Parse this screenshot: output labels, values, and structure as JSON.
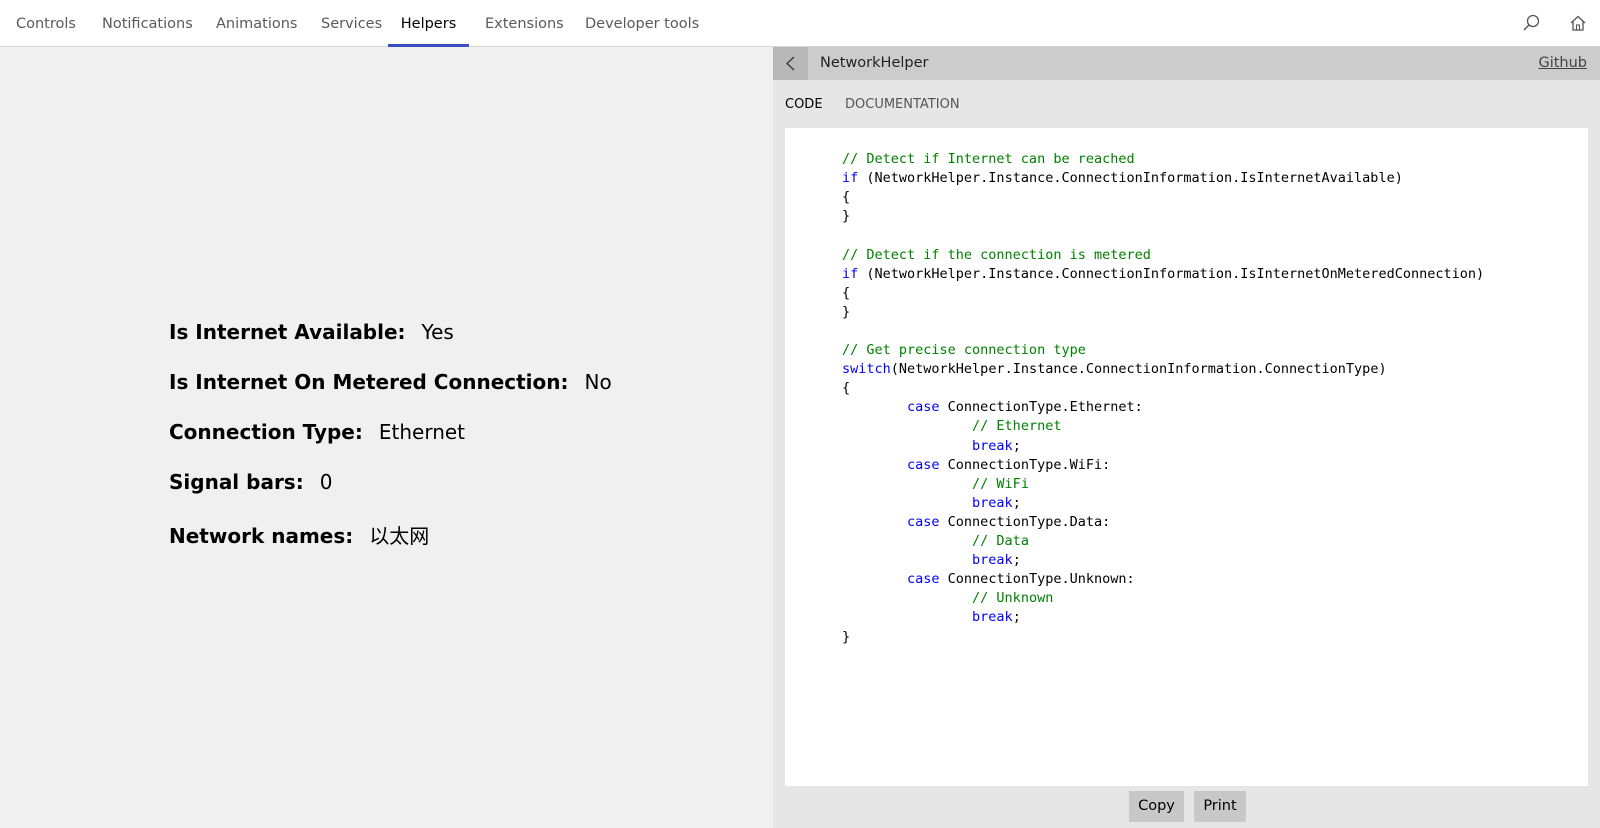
{
  "nav": {
    "items": [
      {
        "label": "Controls",
        "active": false
      },
      {
        "label": "Notifications",
        "active": false
      },
      {
        "label": "Animations",
        "active": false
      },
      {
        "label": "Services",
        "active": false
      },
      {
        "label": "Helpers",
        "active": true
      },
      {
        "label": "Extensions",
        "active": false
      },
      {
        "label": "Developer tools",
        "active": false
      }
    ],
    "icons": {
      "search": "search-icon",
      "home": "home-icon"
    }
  },
  "colors": {
    "accent": "#3a4fc0",
    "nav_background": "#ffffff",
    "content_background": "#f0f0f0",
    "panel_background": "#e6e6e6",
    "panel_header": "#cccccc",
    "code_comment": "#008000",
    "code_keyword": "#0000ff",
    "button_background": "#c8c8c8"
  },
  "network_info": [
    {
      "label": "Is Internet Available:",
      "value": "Yes"
    },
    {
      "label": "Is Internet On Metered Connection:",
      "value": "No"
    },
    {
      "label": "Connection Type:",
      "value": "Ethernet"
    },
    {
      "label": "Signal bars:",
      "value": "0"
    },
    {
      "label": "Network names:",
      "value": "以太网"
    }
  ],
  "panel": {
    "title": "NetworkHelper",
    "github_link": "Github",
    "back_icon": "chevron-left-icon",
    "tabs": [
      {
        "label": "CODE",
        "active": true
      },
      {
        "label": "DOCUMENTATION",
        "active": false
      }
    ],
    "code_lines": [
      [
        {
          "t": "// Detect if Internet can be reached",
          "c": "comment"
        }
      ],
      [
        {
          "t": "if",
          "c": "keyword"
        },
        {
          "t": " (NetworkHelper.Instance.ConnectionInformation.IsInternetAvailable)",
          "c": ""
        }
      ],
      [
        {
          "t": "{",
          "c": ""
        }
      ],
      [
        {
          "t": "}",
          "c": ""
        }
      ],
      [],
      [
        {
          "t": "// Detect if the connection is metered",
          "c": "comment"
        }
      ],
      [
        {
          "t": "if",
          "c": "keyword"
        },
        {
          "t": " (NetworkHelper.Instance.ConnectionInformation.IsInternetOnMeteredConnection)",
          "c": ""
        }
      ],
      [
        {
          "t": "{",
          "c": ""
        }
      ],
      [
        {
          "t": "}",
          "c": ""
        }
      ],
      [],
      [
        {
          "t": "// Get precise connection type",
          "c": "comment"
        }
      ],
      [
        {
          "t": "switch",
          "c": "keyword"
        },
        {
          "t": "(NetworkHelper.Instance.ConnectionInformation.ConnectionType)",
          "c": ""
        }
      ],
      [
        {
          "t": "{",
          "c": ""
        }
      ],
      [
        {
          "t": "        ",
          "c": ""
        },
        {
          "t": "case",
          "c": "keyword"
        },
        {
          "t": " ConnectionType.Ethernet:",
          "c": ""
        }
      ],
      [
        {
          "t": "                ",
          "c": ""
        },
        {
          "t": "// Ethernet",
          "c": "comment"
        }
      ],
      [
        {
          "t": "                ",
          "c": ""
        },
        {
          "t": "break",
          "c": "keyword"
        },
        {
          "t": ";",
          "c": ""
        }
      ],
      [
        {
          "t": "        ",
          "c": ""
        },
        {
          "t": "case",
          "c": "keyword"
        },
        {
          "t": " ConnectionType.WiFi:",
          "c": ""
        }
      ],
      [
        {
          "t": "                ",
          "c": ""
        },
        {
          "t": "// WiFi",
          "c": "comment"
        }
      ],
      [
        {
          "t": "                ",
          "c": ""
        },
        {
          "t": "break",
          "c": "keyword"
        },
        {
          "t": ";",
          "c": ""
        }
      ],
      [
        {
          "t": "        ",
          "c": ""
        },
        {
          "t": "case",
          "c": "keyword"
        },
        {
          "t": " ConnectionType.Data:",
          "c": ""
        }
      ],
      [
        {
          "t": "                ",
          "c": ""
        },
        {
          "t": "// Data",
          "c": "comment"
        }
      ],
      [
        {
          "t": "                ",
          "c": ""
        },
        {
          "t": "break",
          "c": "keyword"
        },
        {
          "t": ";",
          "c": ""
        }
      ],
      [
        {
          "t": "        ",
          "c": ""
        },
        {
          "t": "case",
          "c": "keyword"
        },
        {
          "t": " ConnectionType.Unknown:",
          "c": ""
        }
      ],
      [
        {
          "t": "                ",
          "c": ""
        },
        {
          "t": "// Unknown",
          "c": "comment"
        }
      ],
      [
        {
          "t": "                ",
          "c": ""
        },
        {
          "t": "break",
          "c": "keyword"
        },
        {
          "t": ";",
          "c": ""
        }
      ],
      [
        {
          "t": "}",
          "c": ""
        }
      ]
    ],
    "buttons": {
      "copy": "Copy",
      "print": "Print"
    }
  }
}
